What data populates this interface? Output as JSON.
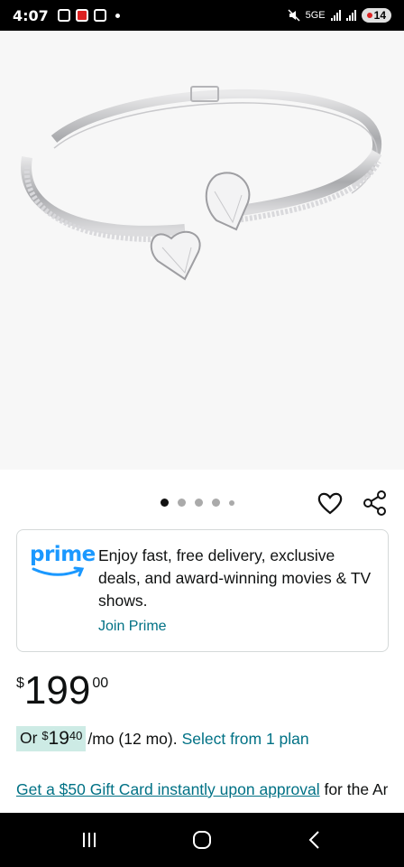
{
  "status_bar": {
    "time": "4:07",
    "network": "5GE",
    "battery": "14"
  },
  "product": {
    "image_alt": "silver-bangle-with-heart-crystals"
  },
  "carousel": {
    "dot_count": 5,
    "active_index": 0
  },
  "prime": {
    "logo_text": "prime",
    "description": "Enjoy fast, free delivery, exclusive deals, and award-winning movies & TV shows.",
    "join_label": "Join Prime"
  },
  "price": {
    "currency": "$",
    "whole": "199",
    "fraction": "00"
  },
  "monthly": {
    "prefix": "Or ",
    "currency": "$",
    "whole": "19",
    "fraction": "40",
    "suffix": "/mo (12 mo).",
    "plan_link": "Select from 1 plan"
  },
  "gift": {
    "link_text": "Get a $50 Gift Card instantly upon approval",
    "text_after": " for the Amazon.ca Rewards Mastercard. No annual"
  },
  "colors": {
    "link": "#007185",
    "prime_blue": "#1a98ff",
    "highlight": "#cdebe5"
  }
}
